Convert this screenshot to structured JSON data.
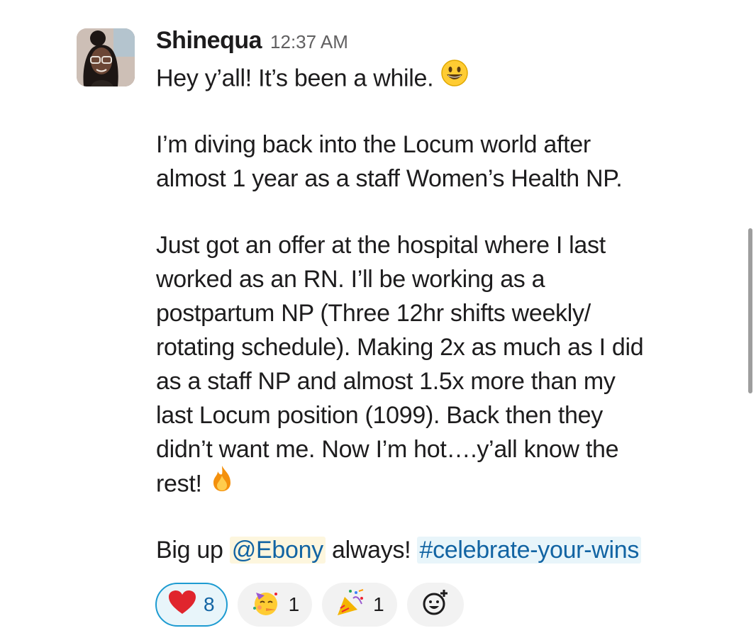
{
  "message": {
    "sender": "Shinequa",
    "timestamp": "12:37 AM",
    "lines": [
      "Hey y’all! It’s been a while.",
      "I’m diving back into the Locum world after",
      "almost 1 year as a staff Women’s Health NP.",
      "Just got an offer at the hospital where I last",
      "worked as an RN. I’ll be working as a",
      "postpartum NP (Three 12hr shifts weekly/",
      "rotating schedule). Making 2x as much as I did",
      "as a staff NP and almost 1.5x more than my",
      "last Locum position (1099). Back then they",
      "didn’t want me. Now I’m hot….y’all know the",
      "rest!"
    ],
    "final_prefix": "Big up ",
    "mention": "@Ebony",
    "final_middle": " always! ",
    "channel": "#celebrate-your-wins",
    "inline_emojis": [
      "smiley-icon",
      "fire-icon"
    ]
  },
  "reactions": [
    {
      "icon": "heart-icon",
      "count": "8",
      "active": true
    },
    {
      "icon": "partying-face-icon",
      "count": "1",
      "active": false
    },
    {
      "icon": "party-popper-icon",
      "count": "1",
      "active": false
    }
  ],
  "add_reaction_icon": "add-reaction-icon",
  "colors": {
    "link": "#1264a3",
    "mention_bg": "#fdf6de",
    "channel_bg": "#e8f5fa",
    "active_border": "#1d9bd1"
  }
}
